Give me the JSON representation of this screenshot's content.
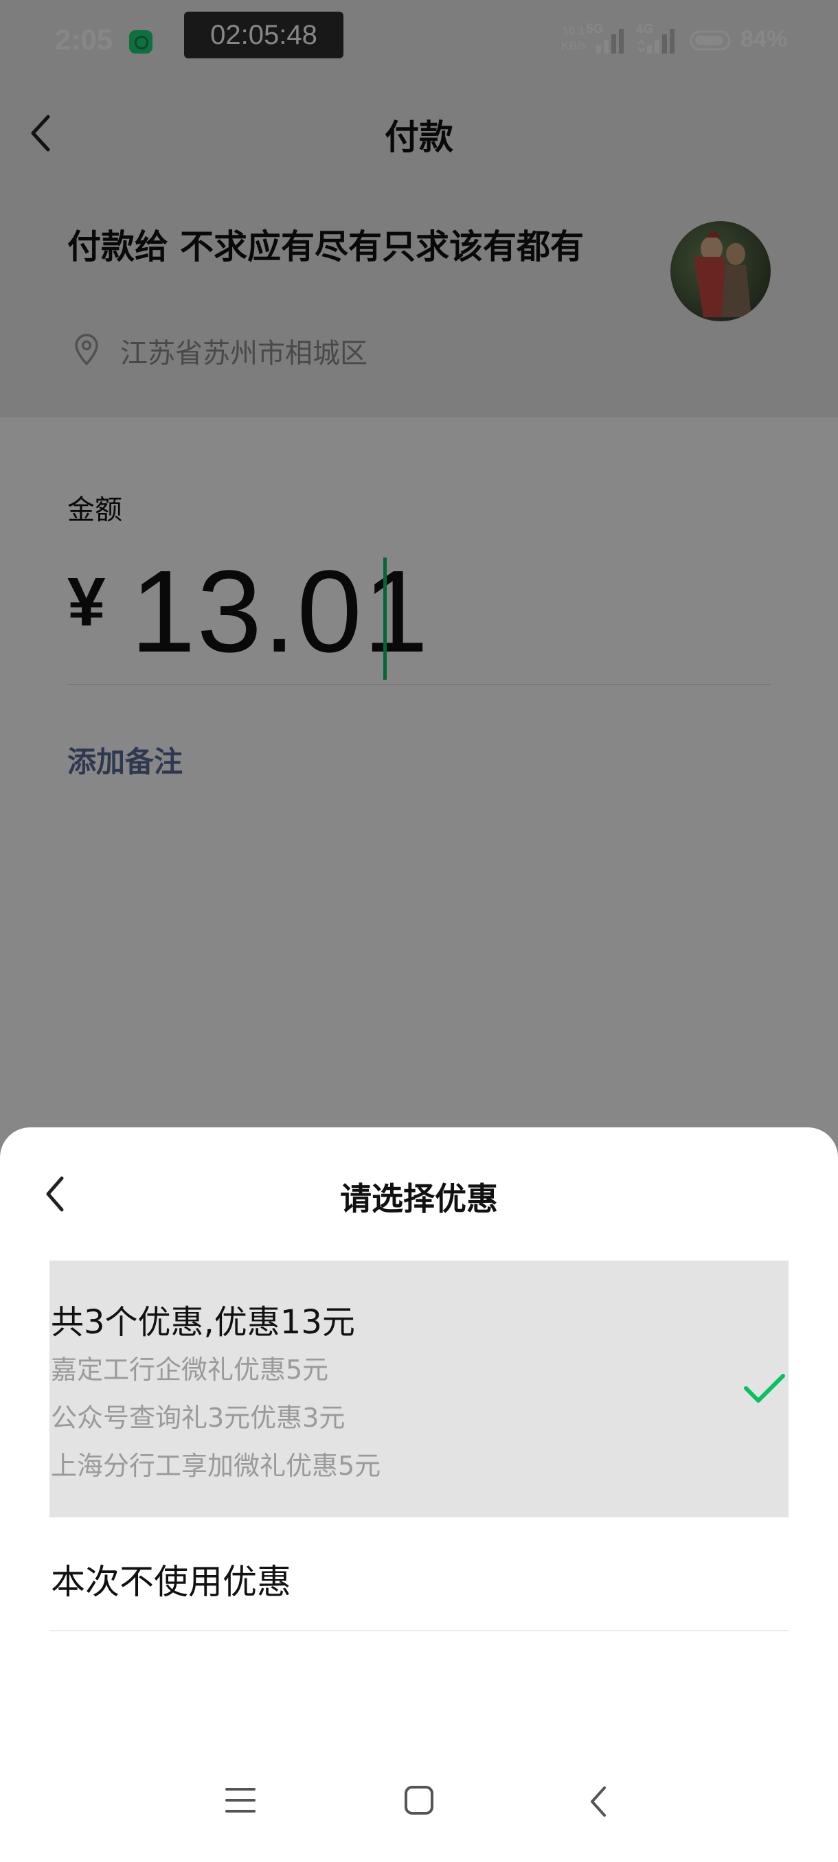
{
  "status_bar": {
    "time": "2:05",
    "recording_timer": "02:05:48",
    "net_speed_value": "16.1",
    "net_speed_unit": "KB/s",
    "net_type_1": "5G",
    "net_type_2": "4G",
    "battery_percent": "84%"
  },
  "header": {
    "title": "付款"
  },
  "merchant": {
    "payee_line": "付款给 不求应有尽有只求该有都有",
    "location": "江苏省苏州市相城区"
  },
  "amount": {
    "label": "金额",
    "currency": "¥",
    "value": "13.01",
    "add_note": "添加备注"
  },
  "discount_sheet": {
    "title": "请选择优惠",
    "selected_option": {
      "title": "共3个优惠,优惠13元",
      "details": [
        "嘉定工行企微礼优惠5元",
        "公众号查询礼3元优惠3元",
        "上海分行工享加微礼优惠5元"
      ],
      "selected": true
    },
    "no_discount_option": "本次不使用优惠"
  },
  "colors": {
    "accent_green": "#07c160",
    "link_blue": "#576b95"
  },
  "icons": {
    "back": "chevron-left-icon",
    "location": "location-pin-icon",
    "selected": "checkmark-icon",
    "system_menu": "menu-icon",
    "system_home": "home-icon",
    "system_back": "back-icon"
  }
}
